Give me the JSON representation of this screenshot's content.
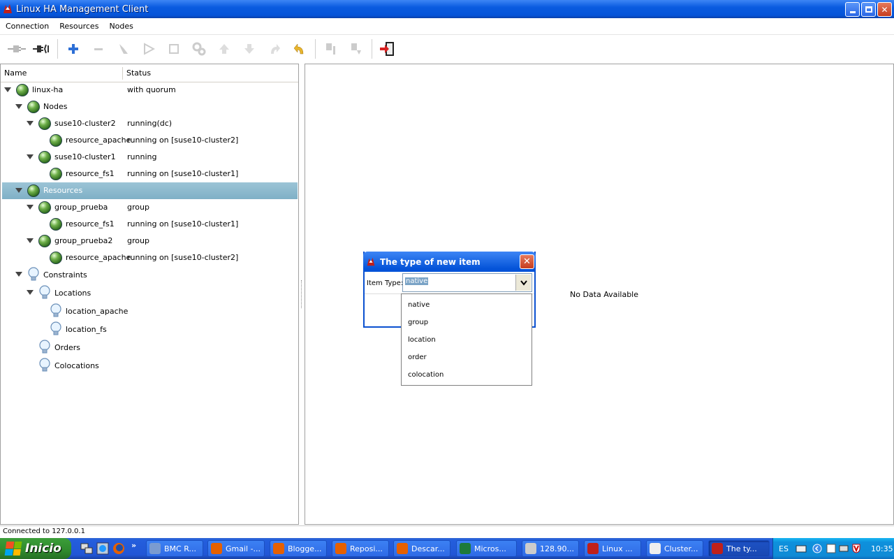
{
  "window": {
    "title": "Linux HA Management Client",
    "min": "_",
    "max": "❐",
    "close": "✕"
  },
  "menu": [
    "Connection",
    "Resources",
    "Nodes"
  ],
  "tree": {
    "columns": [
      "Name",
      "Status"
    ],
    "rows": [
      {
        "name": "linux-ha",
        "status": "with quorum"
      },
      {
        "name": "Nodes",
        "status": ""
      },
      {
        "name": "suse10-cluster2",
        "status": "running(dc)"
      },
      {
        "name": "resource_apache",
        "status": "running on [suse10-cluster2]"
      },
      {
        "name": "suse10-cluster1",
        "status": "running"
      },
      {
        "name": "resource_fs1",
        "status": "running on [suse10-cluster1]"
      },
      {
        "name": "Resources",
        "status": ""
      },
      {
        "name": "group_prueba",
        "status": "group"
      },
      {
        "name": "resource_fs1",
        "status": "running on [suse10-cluster1]"
      },
      {
        "name": "group_prueba2",
        "status": "group"
      },
      {
        "name": "resource_apache",
        "status": "running on [suse10-cluster2]"
      },
      {
        "name": "Constraints",
        "status": ""
      },
      {
        "name": "Locations",
        "status": ""
      },
      {
        "name": "location_apache",
        "status": ""
      },
      {
        "name": "location_fs",
        "status": ""
      },
      {
        "name": "Orders",
        "status": ""
      },
      {
        "name": "Colocations",
        "status": ""
      }
    ]
  },
  "right": {
    "no_data": "No Data Available"
  },
  "status": "Connected to 127.0.0.1",
  "dialog": {
    "title": "The type of new item",
    "item_type_label": "Item Type:",
    "selected": "native",
    "options": [
      "native",
      "group",
      "location",
      "order",
      "colocation"
    ]
  },
  "taskbar": {
    "start": "Inicio",
    "tasks": [
      "BMC R...",
      "Gmail -...",
      "Blogge...",
      "Reposi...",
      "Descar...",
      "Micros...",
      "128.90...",
      "Linux ...",
      "Cluster...",
      "The ty..."
    ],
    "lang": "ES",
    "time": "10:35"
  },
  "colors": {
    "xp_blue": "#0453D8",
    "selection": "#8fbacd",
    "start_green": "#2F8A2D"
  }
}
